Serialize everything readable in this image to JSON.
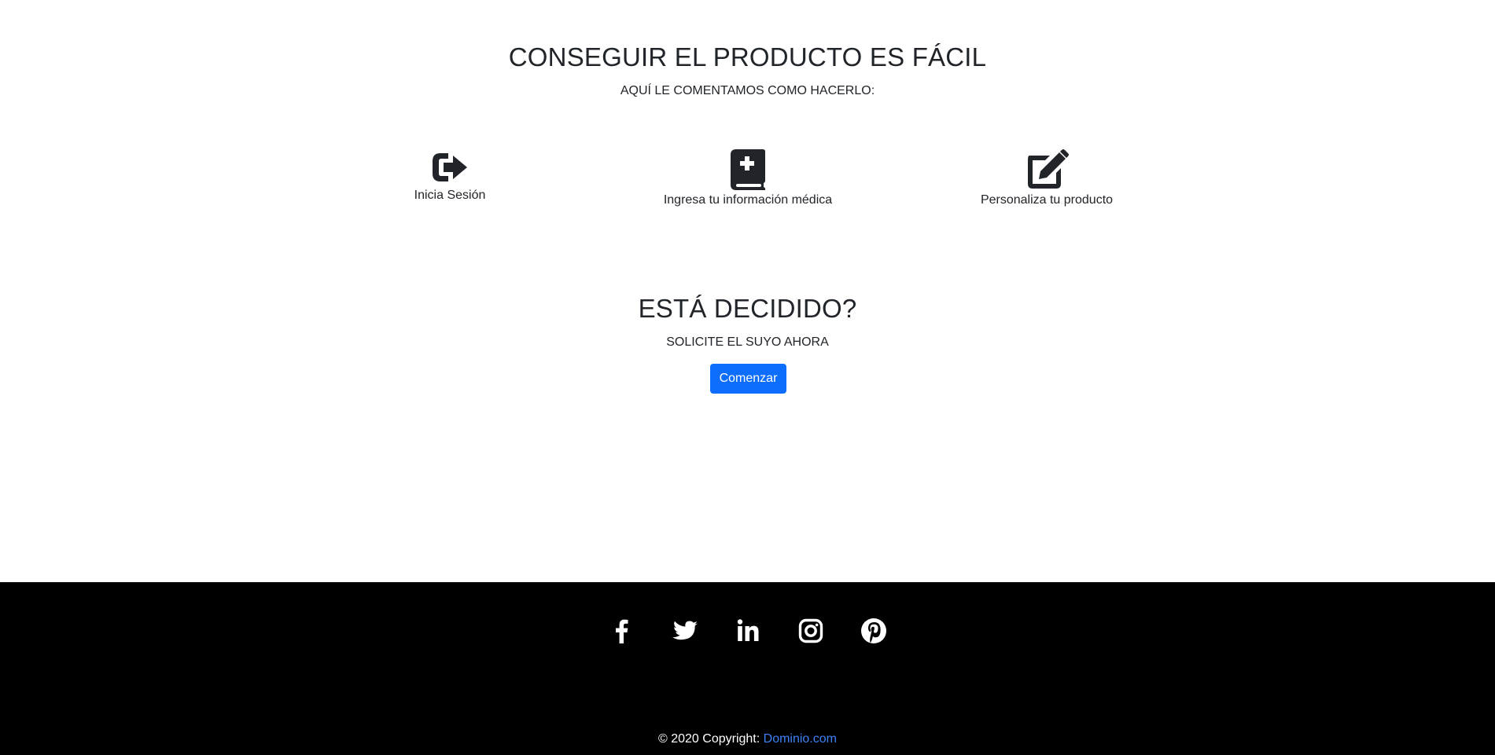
{
  "how": {
    "title": "CONSEGUIR EL PRODUCTO ES FÁCIL",
    "subtitle": "AQUÍ LE COMENTAMOS COMO HACERLO:",
    "steps": [
      {
        "icon": "sign-in-icon",
        "label": "Inicia Sesión"
      },
      {
        "icon": "medical-book-icon",
        "label": "Ingresa tu información médica"
      },
      {
        "icon": "edit-icon",
        "label": "Personaliza tu producto"
      }
    ]
  },
  "cta": {
    "title": "ESTÁ DECIDIDO?",
    "subtitle": "SOLICITE EL SUYO AHORA",
    "button_label": "Comenzar",
    "button_color": "#0d6efd"
  },
  "footer": {
    "background": "#000000",
    "social": [
      "facebook-icon",
      "twitter-icon",
      "linkedin-icon",
      "instagram-icon",
      "pinterest-icon"
    ],
    "copyright_prefix": "© 2020 Copyright: ",
    "copyright_link": "Dominio.com",
    "link_color": "#3b82f6"
  }
}
